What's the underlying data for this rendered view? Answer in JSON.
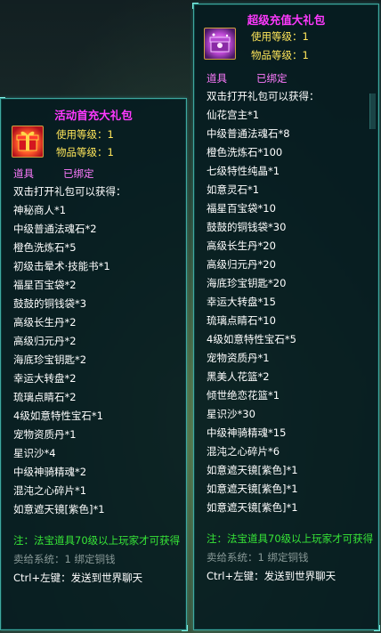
{
  "left_tooltip": {
    "title": "活动首充大礼包",
    "use_level": "使用等级：1",
    "item_level": "物品等级：1",
    "category": "道具",
    "bound": "已绑定",
    "intro": "双击打开礼包可以获得：",
    "items": [
      "神秘商人*1",
      "中级普通法魂石*2",
      "橙色洗炼石*5",
      "初级击晕术·技能书*1",
      "福星百宝袋*2",
      "鼓鼓的铜钱袋*3",
      "高级长生丹*2",
      "高级归元丹*2",
      "海底珍宝钥匙*2",
      "幸运大转盘*2",
      "琉璃点睛石*2",
      "4级如意特性宝石*1",
      "宠物资质丹*1",
      "星识沙*4",
      "中级神骑精魂*2",
      "混沌之心碎片*1",
      "如意遮天镜[紫色]*1"
    ],
    "note": "注：法宝道具70级以上玩家才可获得",
    "sell": "卖给系统：1 绑定铜钱",
    "hint": "Ctrl+左键：发送到世界聊天"
  },
  "right_tooltip": {
    "title": "超级充值大礼包",
    "use_level": "使用等级：1",
    "item_level": "物品等级：1",
    "category": "道具",
    "bound": "已绑定",
    "intro": "双击打开礼包可以获得：",
    "items": [
      "仙花宫主*1",
      "中级普通法魂石*8",
      "橙色洗炼石*100",
      "七级特性纯晶*1",
      "如意灵石*1",
      "福星百宝袋*10",
      "鼓鼓的铜钱袋*30",
      "高级长生丹*20",
      "高级归元丹*20",
      "海底珍宝钥匙*20",
      "幸运大转盘*15",
      "琉璃点睛石*10",
      "4级如意特性宝石*5",
      "宠物资质丹*1",
      "黑美人花篮*2",
      "倾世绝恋花篮*1",
      "星识沙*30",
      "中级神骑精魂*15",
      "混沌之心碎片*6",
      "如意遮天镜[紫色]*1",
      "如意遮天镜[紫色]*1",
      "如意遮天镜[紫色]*1"
    ],
    "note": "注：法宝道具70级以上玩家才可获得",
    "sell": "卖给系统：1 绑定铜钱",
    "hint": "Ctrl+左键：发送到世界聊天"
  },
  "colors": {
    "title": "#ff39ff",
    "stat": "#ffe65a",
    "category": "#ff7bff",
    "note": "#37e637",
    "border": "#3fa8a0"
  }
}
